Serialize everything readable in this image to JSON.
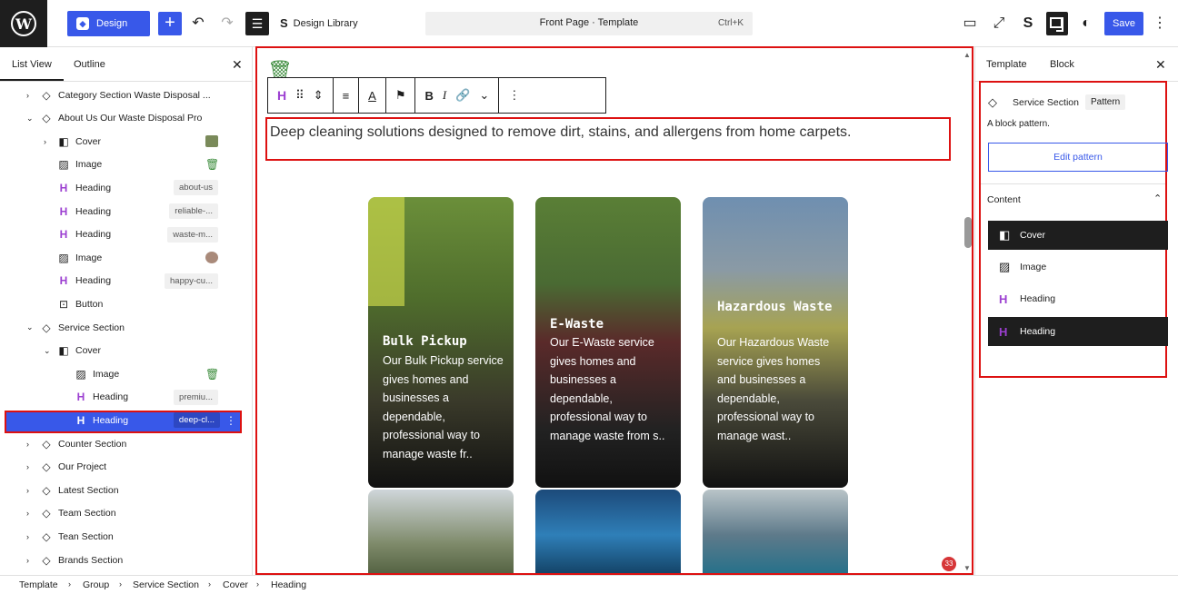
{
  "topbar": {
    "design_label": "Design",
    "design_library_label": "Design Library",
    "command_title": "Front Page · Template",
    "command_shortcut": "Ctrl+K",
    "save_label": "Save"
  },
  "left_panel": {
    "tab_list_view": "List View",
    "tab_outline": "Outline",
    "rows": [
      {
        "label": "Category Section Waste Disposal ...",
        "icon": "pattern-icon"
      },
      {
        "label": "About Us Our Waste Disposal Pro",
        "icon": "pattern-icon"
      },
      {
        "label": "Cover",
        "icon": "cover-icon"
      },
      {
        "label": "Image",
        "icon": "image-icon"
      },
      {
        "label": "Heading",
        "tag": "about-us",
        "icon": "heading-icon"
      },
      {
        "label": "Heading",
        "tag": "reliable-...",
        "icon": "heading-icon"
      },
      {
        "label": "Heading",
        "tag": "waste-m...",
        "icon": "heading-icon"
      },
      {
        "label": "Image",
        "icon": "image-icon"
      },
      {
        "label": "Heading",
        "tag": "happy-cu...",
        "icon": "heading-icon"
      },
      {
        "label": "Button",
        "icon": "button-icon"
      },
      {
        "label": "Service Section",
        "icon": "pattern-icon"
      },
      {
        "label": "Cover",
        "icon": "cover-icon"
      },
      {
        "label": "Image",
        "icon": "image-icon"
      },
      {
        "label": "Heading",
        "tag": "premiu...",
        "icon": "heading-icon"
      },
      {
        "label": "Heading",
        "tag": "deep-cl...",
        "icon": "heading-icon"
      },
      {
        "label": "Counter Section",
        "icon": "pattern-icon"
      },
      {
        "label": "Our Project",
        "icon": "pattern-icon"
      },
      {
        "label": "Latest Section",
        "icon": "pattern-icon"
      },
      {
        "label": "Team Section",
        "icon": "pattern-icon"
      },
      {
        "label": "Tean Section",
        "icon": "pattern-icon"
      },
      {
        "label": "Brands Section",
        "icon": "pattern-icon"
      }
    ]
  },
  "canvas": {
    "paragraph": "Deep cleaning solutions designed to remove dirt, stains, and allergens from home carpets.",
    "cards": [
      {
        "title": "Bulk Pickup",
        "desc": "Our Bulk Pickup service gives homes and businesses a dependable, professional way to manage waste fr.."
      },
      {
        "title": "E-Waste",
        "desc": "Our E-Waste service gives homes and businesses a dependable, professional way to manage waste from s.."
      },
      {
        "title": "Hazardous Waste",
        "desc": "Our Hazardous Waste service gives homes and businesses a dependable, professional way to manage wast.."
      }
    ],
    "notification_count": "33"
  },
  "right_panel": {
    "tab_template": "Template",
    "tab_block": "Block",
    "block_title": "Service Section",
    "pattern_tag": "Pattern",
    "block_desc": "A block pattern.",
    "edit_pattern_label": "Edit pattern",
    "content_heading": "Content",
    "content_items": [
      "Cover",
      "Image",
      "Heading",
      "Heading"
    ]
  },
  "breadcrumbs": [
    "Template",
    "Group",
    "Service Section",
    "Cover",
    "Heading"
  ],
  "colors": {
    "accent": "#3858e9",
    "selection_outline": "#dd1111",
    "heading_icon": "#9c3fd1",
    "trash_icon": "#3b8b3b"
  }
}
